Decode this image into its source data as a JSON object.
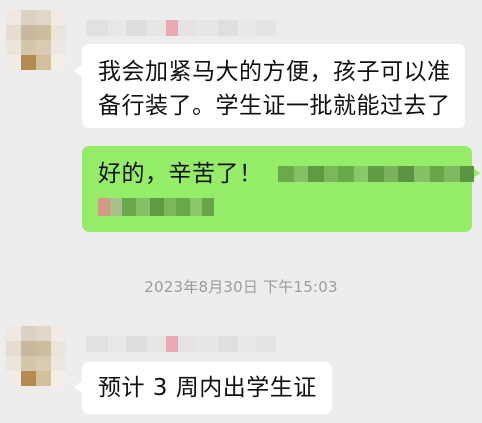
{
  "chat": {
    "messages": [
      {
        "id": "m1",
        "side": "left",
        "text": "我会加紧马大的方便，孩子可以准备行装了。学生证一批就能过去了"
      },
      {
        "id": "m2",
        "side": "right",
        "text": "好的，辛苦了！"
      },
      {
        "id": "m3",
        "side": "left",
        "text": "预计 3 周内出学生证"
      }
    ],
    "timestamp": "2023年8月30日 下午15:03"
  },
  "colors": {
    "background": "#ededed",
    "received_bubble": "#ffffff",
    "sent_bubble": "#95ec69",
    "timestamp_text": "#9c9c9c"
  },
  "icons": {
    "avatar": "avatar-mosaic"
  }
}
